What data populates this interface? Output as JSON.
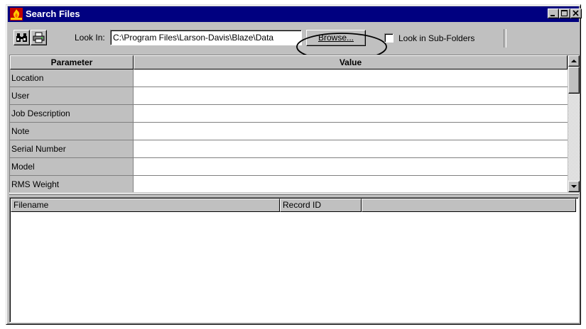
{
  "window": {
    "title": "Search Files",
    "icon": "blaze-app-icon"
  },
  "toolbar": {
    "find_icon": "binoculars-icon",
    "print_icon": "printer-icon",
    "look_in_label": "Look In:",
    "path_value": "C:\\Program Files\\Larson-Davis\\Blaze\\Data",
    "browse_label": "Browse...",
    "subfolders_label": "Look in Sub-Folders",
    "subfolders_checked": false
  },
  "grid": {
    "headers": {
      "parameter": "Parameter",
      "value": "Value"
    },
    "rows": [
      {
        "parameter": "Location",
        "value": ""
      },
      {
        "parameter": "User",
        "value": ""
      },
      {
        "parameter": "Job Description",
        "value": ""
      },
      {
        "parameter": "Note",
        "value": ""
      },
      {
        "parameter": "Serial Number",
        "value": ""
      },
      {
        "parameter": "Model",
        "value": ""
      },
      {
        "parameter": "RMS Weight",
        "value": ""
      }
    ]
  },
  "results": {
    "columns": [
      {
        "label": "Filename"
      },
      {
        "label": "Record ID"
      },
      {
        "label": ""
      }
    ]
  }
}
